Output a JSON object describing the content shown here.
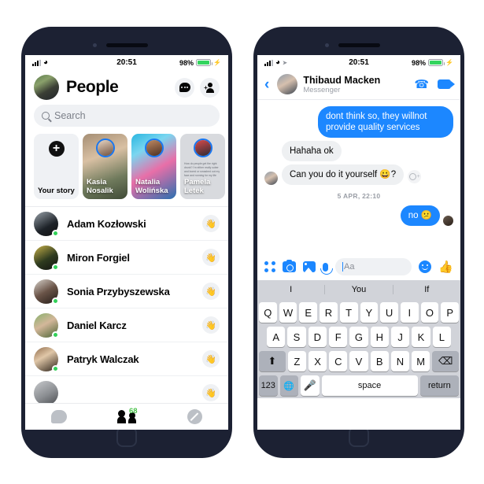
{
  "left_phone": {
    "status": {
      "time": "20:51",
      "battery": "98%",
      "signal_icon": "signal-bars-icon",
      "wifi_icon": "wifi-icon",
      "charging_icon": "charging-bolt-icon"
    },
    "header": {
      "title": "People",
      "avatar_name": "my-avatar",
      "chat_icon": "new-message-icon",
      "add_icon": "add-contact-icon"
    },
    "search": {
      "placeholder": "Search",
      "icon": "search-icon"
    },
    "stories": [
      {
        "name": "Your story",
        "type": "add",
        "icon": "plus-icon"
      },
      {
        "name": "Kasia Nosalik",
        "type": "photo"
      },
      {
        "name": "Natalia Wolińska",
        "type": "photo"
      },
      {
        "name": "Pamela Letek",
        "type": "text",
        "body": "How do people get the right drunk? I'm either really sober and bored or smashed out my face and running for my life"
      }
    ],
    "people": [
      {
        "name": "Adam Kozłowski",
        "online": true,
        "action_icon": "wave-icon",
        "action_glyph": "👋"
      },
      {
        "name": "Miron Forgiel",
        "online": true,
        "action_icon": "wave-icon",
        "action_glyph": "👋"
      },
      {
        "name": "Sonia Przybyszewska",
        "online": true,
        "action_icon": "wave-icon",
        "action_glyph": "👋"
      },
      {
        "name": "Daniel Karcz",
        "online": true,
        "action_icon": "wave-icon",
        "action_glyph": "👋"
      },
      {
        "name": "Patryk Walczak",
        "online": true,
        "action_icon": "wave-icon",
        "action_glyph": "👋"
      },
      {
        "name": "",
        "online": false,
        "action_icon": "wave-icon",
        "action_glyph": "👋"
      }
    ],
    "tabbar": [
      {
        "name": "chats-tab",
        "icon": "chat-bubble-icon",
        "active": false
      },
      {
        "name": "people-tab",
        "icon": "people-icon",
        "active": true,
        "badge": "68"
      },
      {
        "name": "discover-tab",
        "icon": "circle-slash-icon",
        "active": false
      }
    ]
  },
  "right_phone": {
    "status": {
      "time": "20:51",
      "battery": "98%",
      "signal_icon": "signal-bars-icon",
      "wifi_icon": "wifi-icon",
      "location_icon": "location-arrow-icon",
      "charging_icon": "charging-bolt-icon"
    },
    "header": {
      "back_icon": "back-chevron-icon",
      "name": "Thibaud Macken",
      "subtitle": "Messenger",
      "call_icon": "phone-icon",
      "video_icon": "video-camera-icon"
    },
    "messages": [
      {
        "side": "out",
        "text": "dont think so, they willnot provide quality services"
      },
      {
        "side": "in",
        "text": "Hahaha ok"
      },
      {
        "side": "in",
        "text": "Can you do it yourself 😀?",
        "has_reaction_button": true
      },
      {
        "side": "out",
        "text": "no 😕"
      }
    ],
    "timestamp": "5 APR, 22:10",
    "react_button": {
      "icon": "add-reaction-icon",
      "plus": "+"
    },
    "composer": {
      "grid_icon": "apps-grid-icon",
      "camera_icon": "camera-icon",
      "gallery_icon": "photo-gallery-icon",
      "mic_icon": "microphone-icon",
      "placeholder": "Aa",
      "emoji_icon": "emoji-smiley-icon",
      "thumb_icon": "thumbs-up-icon",
      "thumb_glyph": "👍"
    },
    "keyboard": {
      "suggestions": [
        "I",
        "You",
        "If"
      ],
      "row1": [
        "Q",
        "W",
        "E",
        "R",
        "T",
        "Y",
        "U",
        "I",
        "O",
        "P"
      ],
      "row2": [
        "A",
        "S",
        "D",
        "F",
        "G",
        "H",
        "J",
        "K",
        "L"
      ],
      "row3_shift": "⬆",
      "row3": [
        "Z",
        "X",
        "C",
        "V",
        "B",
        "N",
        "M"
      ],
      "row3_backspace": "⌫",
      "numeric_key": "123",
      "globe_key": "🌐",
      "mic_key": "🎤",
      "space_key": "space",
      "return_key": "return"
    }
  },
  "colors": {
    "messenger_blue": "#1c87ff",
    "frame_navy": "#1c2133",
    "online_green": "#31d158",
    "badge_green": "#4cc24c",
    "bubble_grey": "#eef0f2",
    "keyboard_grey": "#d1d3d9"
  }
}
